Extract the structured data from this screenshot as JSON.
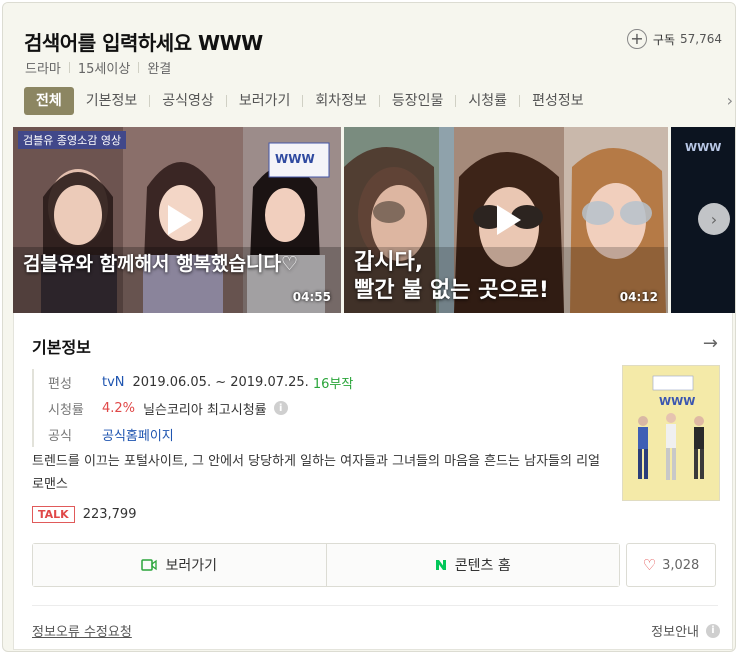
{
  "header": {
    "title": "검색어를 입력하세요 WWW",
    "meta": [
      "드라마",
      "15세이상",
      "완결"
    ],
    "subscribe_label": "구독",
    "subscribe_count": "57,764"
  },
  "tabs": [
    {
      "label": "전체",
      "active": true
    },
    {
      "label": "기본정보"
    },
    {
      "label": "공식영상"
    },
    {
      "label": "보러가기"
    },
    {
      "label": "회차정보"
    },
    {
      "label": "등장인물"
    },
    {
      "label": "시청률"
    },
    {
      "label": "편성정보"
    }
  ],
  "videos": [
    {
      "tag": "검블유 종영소감 영상",
      "caption": "검블유와 함께해서 행복했습니다♡",
      "duration": "04:55",
      "logo": "WWW"
    },
    {
      "caption_line1": "갑시다,",
      "caption_line2": "빨간 불 없는 곳으로!",
      "duration": "04:12"
    },
    {
      "logo": "WWW"
    }
  ],
  "info": {
    "section_title": "기본정보",
    "rows": {
      "schedule_key": "편성",
      "channel": "tvN",
      "dates": "2019.06.05. ~ 2019.07.25.",
      "episodes": "16부작",
      "rating_key": "시청률",
      "rating": "4.2%",
      "rating_source": "닐슨코리아",
      "rating_note": "최고시청률",
      "official_key": "공식",
      "official_link": "공식홈페이지"
    },
    "description": "트렌드를 이끄는 포털사이트, 그 안에서 당당하게 일하는 여자들과 그녀들의 마음을 흔드는 남자들의 리얼 로맨스",
    "poster_logo": "WWW",
    "talk_label": "TALK",
    "talk_count": "223,799",
    "watch_button": "보러가기",
    "content_home_button": "콘텐츠 홈",
    "like_count": "3,028",
    "report_link": "정보오류 수정요청",
    "guide_label": "정보안내"
  },
  "colors": {
    "accent_tab": "#8c8662",
    "rating_red": "#e04848",
    "episodes_green": "#2aa53a",
    "link_blue": "#1f55b0",
    "naver_green": "#03c75a"
  }
}
